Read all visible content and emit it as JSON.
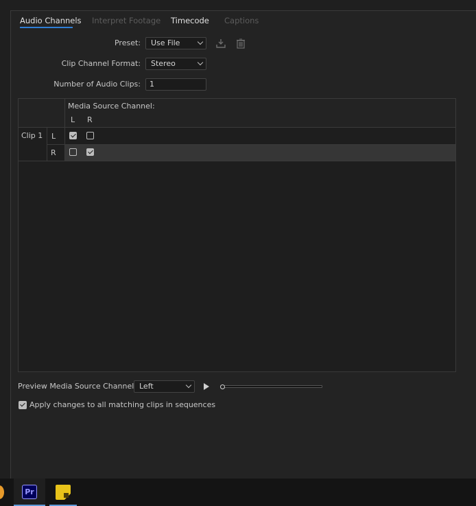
{
  "tabs": [
    {
      "label": "Audio Channels",
      "state": "active"
    },
    {
      "label": "Interpret Footage",
      "state": "disabled"
    },
    {
      "label": "Timecode",
      "state": "enabled"
    },
    {
      "label": "Captions",
      "state": "disabled"
    }
  ],
  "form": {
    "preset_label": "Preset:",
    "preset_value": "Use File",
    "clip_channel_format_label": "Clip Channel Format:",
    "clip_channel_format_value": "Stereo",
    "num_audio_clips_label": "Number of Audio Clips:",
    "num_audio_clips_value": "1"
  },
  "icons": {
    "save_preset": "download-icon",
    "delete_preset": "trash-icon"
  },
  "grid": {
    "header_title": "Media Source Channel:",
    "source_channels": [
      "L",
      "R"
    ],
    "rows": [
      {
        "clip": "Clip 1",
        "channel": "L",
        "checks": [
          true,
          false
        ]
      },
      {
        "clip": "",
        "channel": "R",
        "checks": [
          false,
          true
        ]
      }
    ]
  },
  "preview": {
    "label": "Preview Media Source Channel:",
    "value": "Left",
    "position": 0.0
  },
  "apply": {
    "label": "Apply changes to all matching clips in sequences",
    "checked": true
  },
  "taskbar": {
    "apps": [
      "app-icon",
      "Pr",
      "sticky-notes-icon"
    ]
  },
  "colors": {
    "accent": "#2f7fd6",
    "premiere_bg": "#00005b",
    "premiere_text": "#9999ff",
    "sticky_yellow": "#e8c31a"
  }
}
